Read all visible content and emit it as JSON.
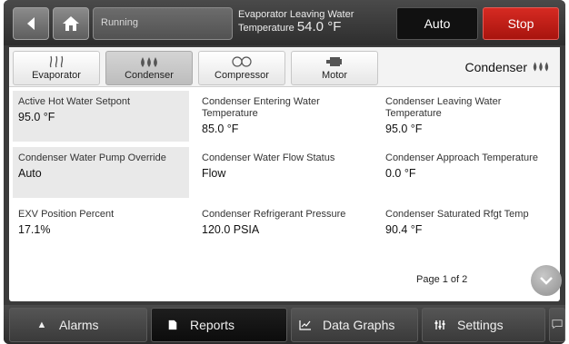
{
  "topbar": {
    "status": "Running",
    "evap_label": "Evaporator Leaving Water",
    "evap_temp_label": "Temperature",
    "evap_temp_value": "54.0 °F",
    "auto_label": "Auto",
    "stop_label": "Stop"
  },
  "tabs": [
    {
      "label": "Evaporator",
      "icon": "evaporator-icon"
    },
    {
      "label": "Condenser",
      "icon": "condenser-icon"
    },
    {
      "label": "Compressor",
      "icon": "compressor-icon"
    },
    {
      "label": "Motor",
      "icon": "motor-icon"
    }
  ],
  "section": {
    "title": "Condenser",
    "icon": "condenser-icon"
  },
  "cells": [
    {
      "label": "Active Hot Water Setpont",
      "value": "95.0 °F"
    },
    {
      "label": "Condenser Entering Water Temperature",
      "value": "85.0 °F"
    },
    {
      "label": "Condenser Leaving Water Temperature",
      "value": "95.0 °F"
    },
    {
      "label": "Condenser Water Pump Override",
      "value": "Auto"
    },
    {
      "label": "Condenser Water Flow Status",
      "value": "Flow"
    },
    {
      "label": "Condenser Approach Temperature",
      "value": "0.0 °F"
    },
    {
      "label": "EXV Position Percent",
      "value": "17.1%"
    },
    {
      "label": "Condenser Refrigerant Pressure",
      "value": "120.0 PSIA"
    },
    {
      "label": "Condenser Saturated Rfgt Temp",
      "value": "90.4 °F"
    }
  ],
  "pager": "Page 1 of 2",
  "bottom_nav": [
    {
      "label": "Alarms",
      "icon": "alarm-icon"
    },
    {
      "label": "Reports",
      "icon": "reports-icon"
    },
    {
      "label": "Data Graphs",
      "icon": "graph-icon"
    },
    {
      "label": "Settings",
      "icon": "settings-icon"
    }
  ],
  "colors": {
    "stop": "#c41c16",
    "auto": "#111111",
    "accent": "#3a3a3a"
  }
}
